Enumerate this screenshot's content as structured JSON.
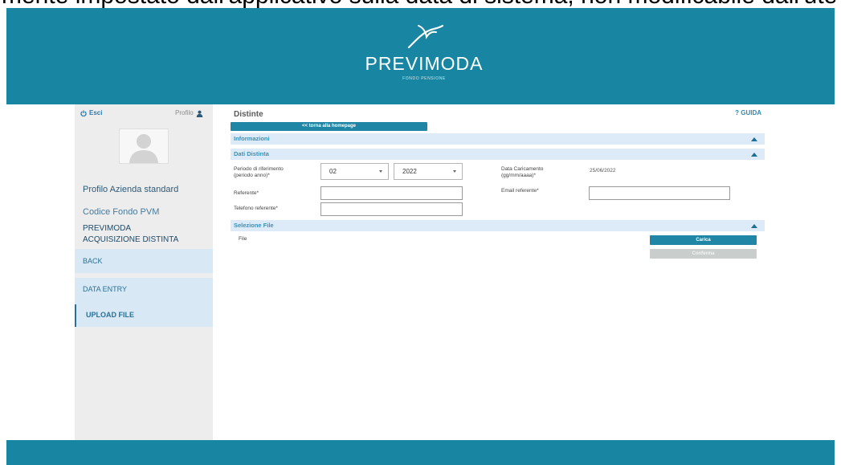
{
  "doc_text": "mente impostato dall'applicativo sulla data di sistema, non modificabile dall'ute",
  "header": {
    "brand": "PREVIMODA",
    "subtitle": "FONDO PENSIONE",
    "logo_icon": "bird-logo-icon"
  },
  "sidebar": {
    "logout_label": "Esci",
    "logout_icon": "power-icon",
    "profile_label": "Profilo",
    "profile_icon": "user-icon",
    "avatar_icon": "avatar-placeholder-icon",
    "profile_name": "Profilo Azienda standard",
    "fund_code": "Codice Fondo PVM",
    "fund_name": "PREVIMODA",
    "section_title": "ACQUISIZIONE DISTINTA",
    "items": [
      {
        "label": "BACK",
        "active": false
      },
      {
        "label": "DATA ENTRY",
        "active": false
      },
      {
        "label": "UPLOAD FILE",
        "active": true
      }
    ]
  },
  "main": {
    "title": "Distinte",
    "help_label": "? GUIDA",
    "home_button": "<< torna alla homepage",
    "sections": [
      {
        "title": "Informazioni",
        "state_icon": "triangle-up-icon"
      },
      {
        "title": "Dati Distinta",
        "state_icon": "triangle-up-icon"
      },
      {
        "title": "Selezione File",
        "state_icon": "triangle-up-icon"
      }
    ],
    "form": {
      "period_label_1": "Periodo di riferimento",
      "period_label_2": "(periodo anno)*",
      "month_value": "02",
      "year_value": "2022",
      "upload_date_label_1": "Data Caricamento",
      "upload_date_label_2": "(gg/mm/aaaa)*",
      "upload_date_value": "25/06/2022",
      "referent_label": "Referente*",
      "referent_value": "",
      "email_label": "Email referente*",
      "email_value": "",
      "phone_label": "Telefono referente*",
      "phone_value": ""
    },
    "file_section": {
      "file_label": "File",
      "upload_button": "Carica",
      "confirm_button": "Conferma"
    }
  },
  "colors": {
    "brand_teal": "#1886a2",
    "button_teal": "#1f86a5",
    "sidebar_bg": "#ededed",
    "nav_band_bg": "#d8e9f5",
    "section_header_bg": "#dcebf7",
    "section_header_text": "#3a90b8",
    "disabled_button": "#c9cdcb"
  }
}
